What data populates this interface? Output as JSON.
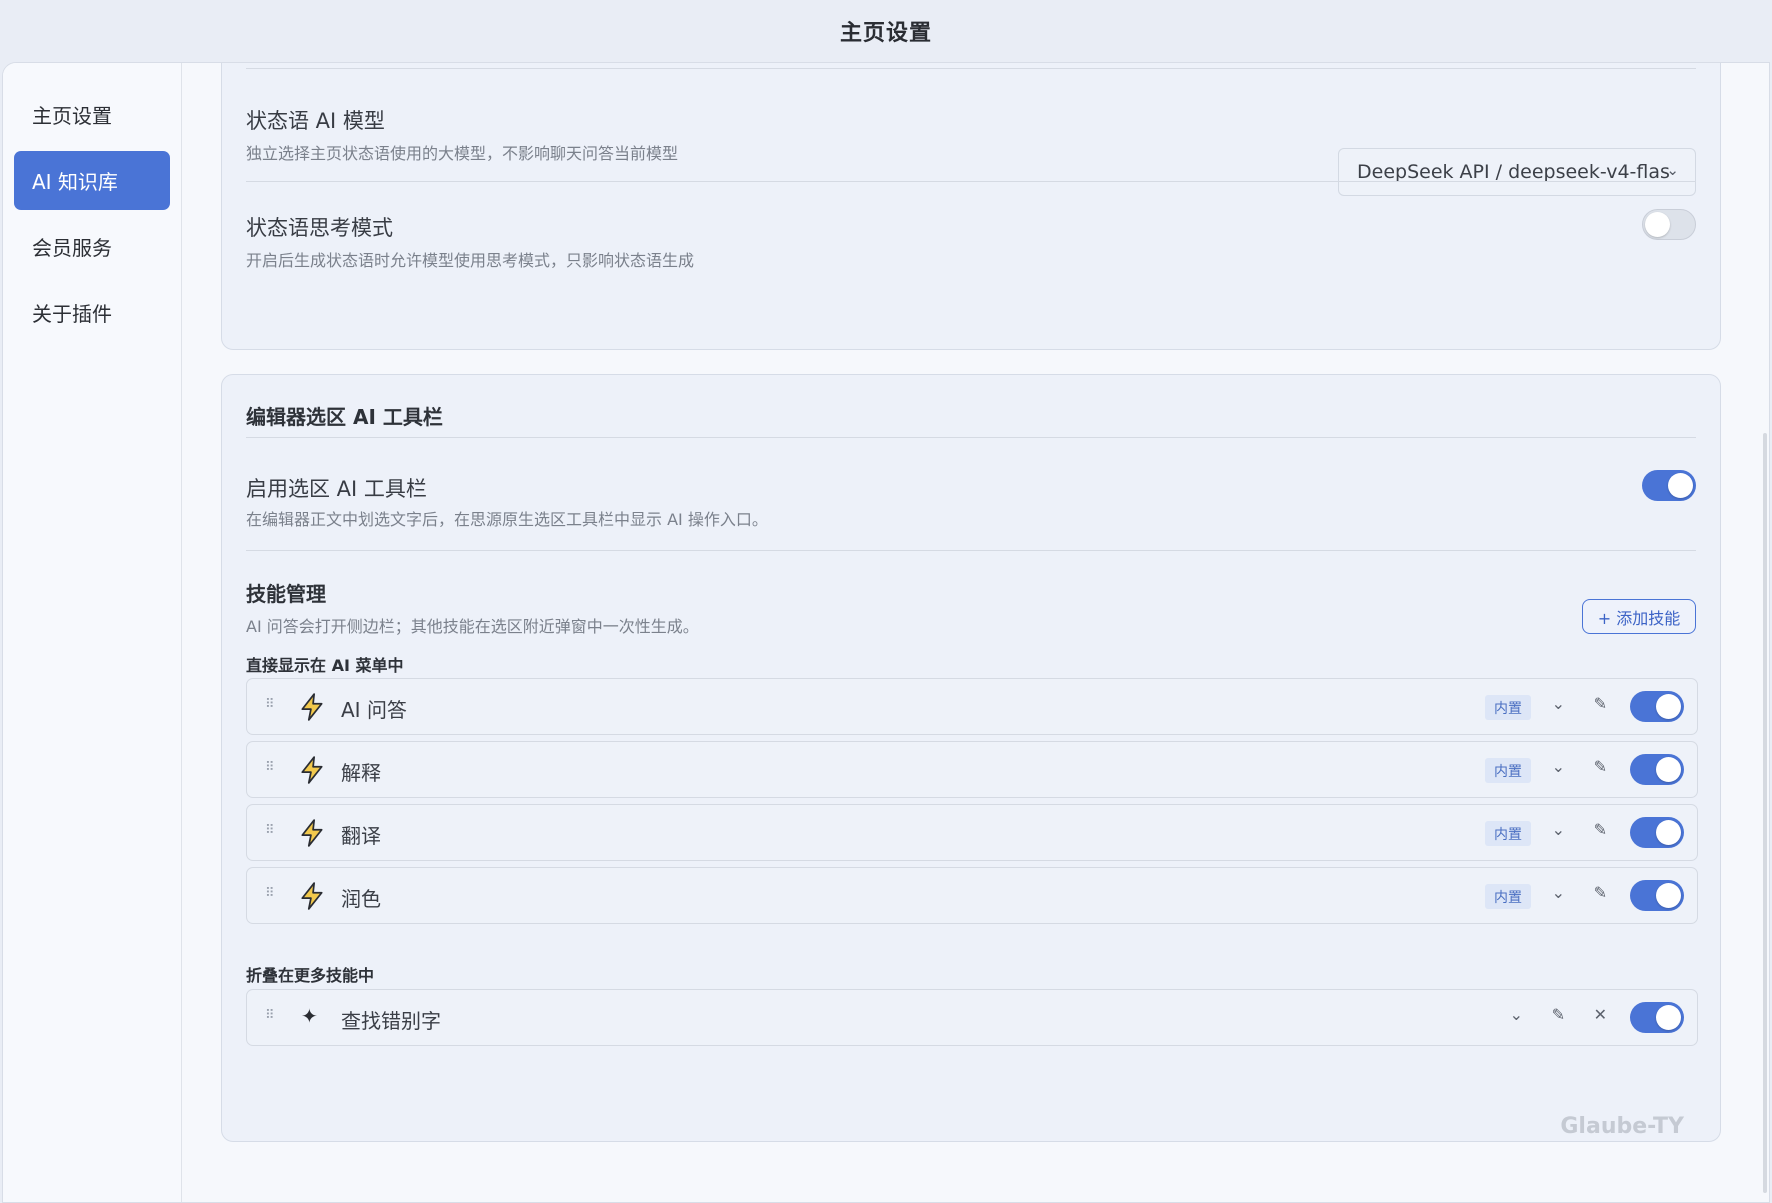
{
  "window": {
    "title": "主页设置"
  },
  "sidebar": {
    "items": [
      {
        "label": "主页设置",
        "active": false
      },
      {
        "label": "AI 知识库",
        "active": true
      },
      {
        "label": "会员服务",
        "active": false
      },
      {
        "label": "关于插件",
        "active": false
      }
    ]
  },
  "status_card": {
    "model": {
      "title": "状态语 AI 模型",
      "desc": "独立选择主页状态语使用的大模型，不影响聊天问答当前模型",
      "selected": "DeepSeek API / deepseek-v4-flas"
    },
    "thinking": {
      "title": "状态语思考模式",
      "desc": "开启后生成状态语时允许模型使用思考模式，只影响状态语生成",
      "enabled": false
    }
  },
  "toolbar_card": {
    "title": "编辑器选区 AI 工具栏",
    "enable": {
      "title": "启用选区 AI 工具栏",
      "desc": "在编辑器正文中划选文字后，在思源原生选区工具栏中显示 AI 操作入口。",
      "enabled": true
    },
    "skills": {
      "title": "技能管理",
      "desc": "AI 问答会打开侧边栏；其他技能在选区附近弹窗中一次性生成。",
      "add_label": "+ 添加技能",
      "direct_label": "直接显示在 AI 菜单中",
      "direct_items": [
        {
          "name": "AI 问答",
          "badge": "内置",
          "enabled": true
        },
        {
          "name": "解释",
          "badge": "内置",
          "enabled": true
        },
        {
          "name": "翻译",
          "badge": "内置",
          "enabled": true
        },
        {
          "name": "润色",
          "badge": "内置",
          "enabled": true
        }
      ],
      "more_label": "折叠在更多技能中",
      "more_items": [
        {
          "name": "查找错别字",
          "enabled": true
        }
      ]
    }
  },
  "icons": {
    "drag": "⠿",
    "expand": "⌄",
    "edit": "✎",
    "delete": "✕",
    "star": "✦",
    "chevron": "⌄"
  },
  "colors": {
    "accent": "#4a74d6",
    "bolt": "#f2c94c"
  },
  "watermark": "Glaube-TY"
}
